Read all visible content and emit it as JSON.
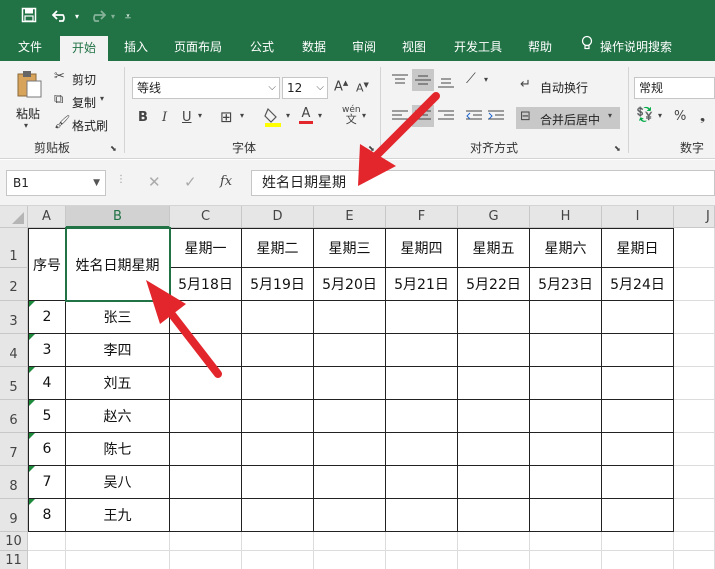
{
  "ribbon_tabs": [
    "文件",
    "开始",
    "插入",
    "页面布局",
    "公式",
    "数据",
    "审阅",
    "视图",
    "开发工具",
    "帮助",
    "操作说明搜索"
  ],
  "clipboard": {
    "paste": "粘贴",
    "cut": "剪切",
    "copy": "复制",
    "format_painter": "格式刷",
    "label": "剪贴板"
  },
  "font": {
    "name": "等线",
    "size": "12",
    "grow": "A",
    "shrink": "A",
    "bold": "B",
    "italic": "I",
    "underline": "U",
    "font_color_letter": "A",
    "phonetic": "wén",
    "label": "字体"
  },
  "alignment": {
    "wrap_text": "自动换行",
    "merge_center": "合并后居中",
    "label": "对齐方式"
  },
  "number": {
    "format": "常规",
    "percent": "%",
    "label": "数字"
  },
  "formula_bar": {
    "name_box": "B1",
    "fx": "fx",
    "content": "姓名日期星期"
  },
  "sheet": {
    "columns": [
      "A",
      "B",
      "C",
      "D",
      "E",
      "F",
      "G",
      "H",
      "I",
      "J"
    ],
    "rows": [
      "1",
      "2",
      "3",
      "4",
      "5",
      "6",
      "7",
      "8",
      "9",
      "10",
      "11"
    ],
    "header_a": "序号",
    "header_b": "姓名日期星期",
    "weekdays": [
      "星期一",
      "星期二",
      "星期三",
      "星期四",
      "星期五",
      "星期六",
      "星期日"
    ],
    "dates": [
      "5月18日",
      "5月19日",
      "5月20日",
      "5月21日",
      "5月22日",
      "5月23日",
      "5月24日"
    ],
    "records": [
      {
        "no": "2",
        "name": "张三"
      },
      {
        "no": "3",
        "name": "李四"
      },
      {
        "no": "4",
        "name": "刘五"
      },
      {
        "no": "5",
        "name": "赵六"
      },
      {
        "no": "6",
        "name": "陈七"
      },
      {
        "no": "7",
        "name": "吴八"
      },
      {
        "no": "8",
        "name": "王九"
      }
    ]
  },
  "colors": {
    "excel_green": "#217346",
    "arrow_red": "#e3252c"
  }
}
